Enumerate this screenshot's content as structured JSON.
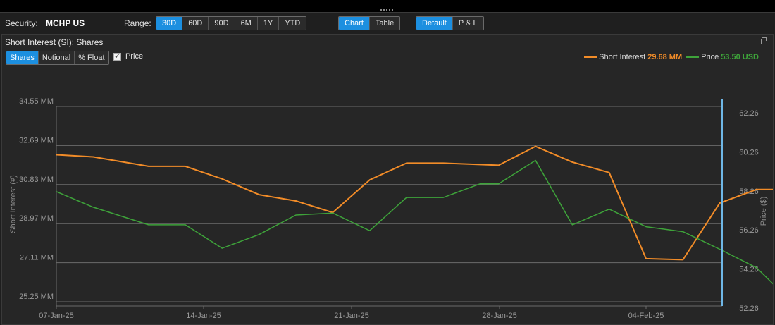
{
  "toolbar": {
    "security_label": "Security:",
    "security_value": "MCHP US",
    "range_label": "Range:",
    "range_options": [
      "30D",
      "60D",
      "90D",
      "6M",
      "1Y",
      "YTD"
    ],
    "range_selected": "30D",
    "view_options": [
      "Chart",
      "Table"
    ],
    "view_selected": "Chart",
    "mode_options": [
      "Default",
      "P & L"
    ],
    "mode_selected": "Default"
  },
  "panel": {
    "title": "Short Interest (SI): Shares",
    "measure_options": [
      "Shares",
      "Notional",
      "% Float"
    ],
    "measure_selected": "Shares",
    "price_checkbox_label": "Price",
    "price_checked": true
  },
  "legend": {
    "short_interest_label": "Short Interest",
    "short_interest_value": "29.68 MM",
    "price_label": "Price",
    "price_value": "53.50 USD"
  },
  "colors": {
    "short_interest": "#f28c28",
    "price": "#3ea33a",
    "accent": "#1c8fe0",
    "cursor": "#6fb7e6"
  },
  "chart_data": {
    "type": "line",
    "x_ticks": [
      "07-Jan-25",
      "14-Jan-25",
      "21-Jan-25",
      "28-Jan-25",
      "04-Feb-25"
    ],
    "x_range": [
      0,
      32
    ],
    "y_left": {
      "label": "Short Interest (#)",
      "ticks": [
        "34.55 MM",
        "32.69 MM",
        "30.83 MM",
        "28.97 MM",
        "27.11 MM",
        "25.25 MM"
      ],
      "range": [
        25.25,
        34.55
      ]
    },
    "y_right": {
      "label": "Price ($)",
      "ticks": [
        "62.26",
        "60.26",
        "58.26",
        "56.26",
        "54.26",
        "52.26"
      ],
      "range": [
        52.26,
        62.26
      ]
    },
    "grid": true,
    "legend_position": "top-right",
    "series": [
      {
        "name": "Short Interest",
        "axis": "left",
        "x": [
          0,
          2,
          5,
          7,
          9,
          11,
          13,
          15,
          17,
          19,
          21,
          24,
          26,
          28,
          30,
          32,
          34,
          36,
          38,
          40,
          41
        ],
        "values": [
          32.25,
          32.15,
          31.7,
          31.7,
          31.1,
          30.35,
          30.05,
          29.5,
          31.05,
          31.85,
          31.85,
          31.75,
          32.65,
          31.9,
          31.4,
          27.3,
          27.25,
          29.95,
          30.6,
          30.6,
          30.0
        ]
      },
      {
        "name": "Price",
        "axis": "right",
        "x": [
          0,
          2,
          5,
          7,
          9,
          11,
          13,
          15,
          17,
          19,
          21,
          23,
          24,
          26,
          28,
          30,
          32,
          34,
          36,
          38,
          40,
          41
        ],
        "values": [
          57.9,
          57.1,
          56.2,
          56.2,
          55.0,
          55.7,
          56.7,
          56.8,
          55.9,
          57.6,
          57.6,
          58.3,
          58.3,
          59.5,
          56.2,
          57.0,
          56.1,
          55.85,
          54.95,
          54.0,
          52.15,
          52.55
        ]
      }
    ]
  }
}
